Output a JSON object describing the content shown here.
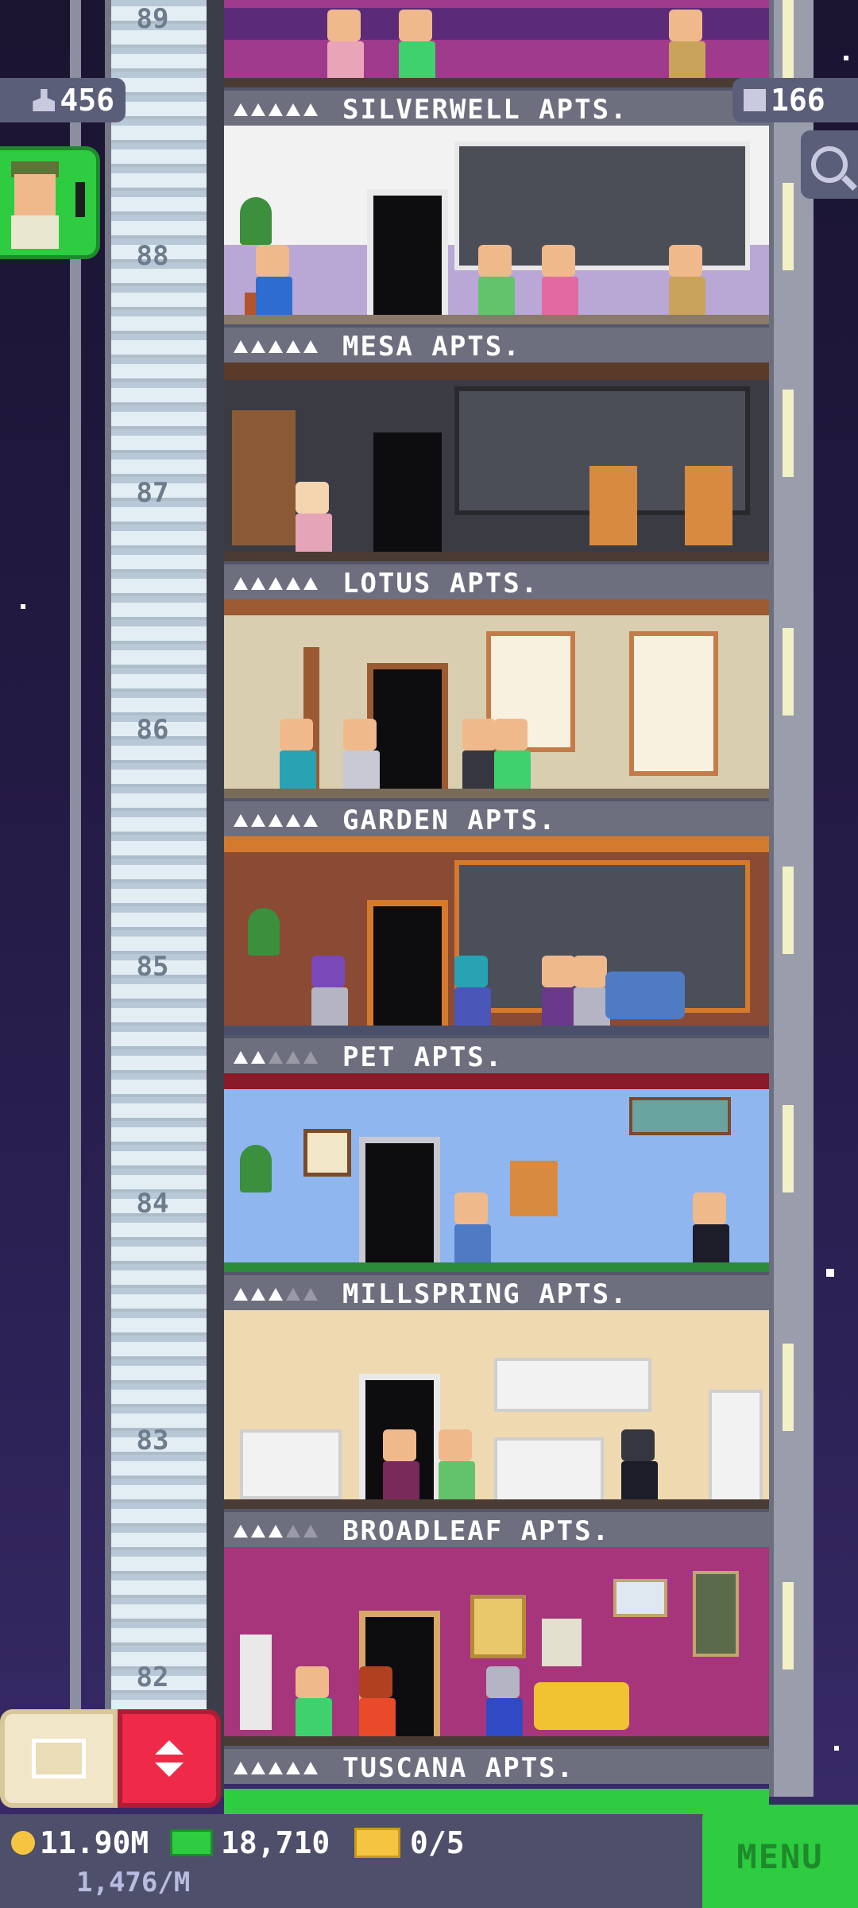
{
  "hud": {
    "population": "456",
    "floor_count": "166",
    "population_icon": "person-icon",
    "floors_icon": "building-icon",
    "search_icon": "magnifier-icon"
  },
  "elevator": {
    "floor_numbers": [
      "89",
      "88",
      "87",
      "86",
      "85",
      "84",
      "83",
      "82"
    ]
  },
  "floors": [
    {
      "name": "SILVERWELL APTS.",
      "stars": 5,
      "theme": "#a03a8c"
    },
    {
      "name": "MESA APTS.",
      "stars": 5,
      "theme": "#f2f2f2"
    },
    {
      "name": "LOTUS APTS.",
      "stars": 5,
      "theme": "#3b3b44"
    },
    {
      "name": "GARDEN APTS.",
      "stars": 5,
      "theme": "#d9cfb0"
    },
    {
      "name": "PET APTS.",
      "stars": 2,
      "theme": "#8b4a33"
    },
    {
      "name": "MILLSPRING APTS.",
      "stars": 3,
      "theme": "#8fb6ef"
    },
    {
      "name": "BROADLEAF APTS.",
      "stars": 3,
      "theme": "#efd9b1"
    },
    {
      "name": "TUSCANA APTS.",
      "stars": 5,
      "theme": "#a6357c"
    }
  ],
  "bottom": {
    "coins": "11.90M",
    "coin_rate": "1,476/M",
    "bux": "18,710",
    "tickets": "0/5",
    "menu_label": "MENU"
  },
  "colors": {
    "accent_green": "#2ecc40",
    "accent_red": "#ef2a48",
    "hud_panel": "#5b5e78"
  }
}
